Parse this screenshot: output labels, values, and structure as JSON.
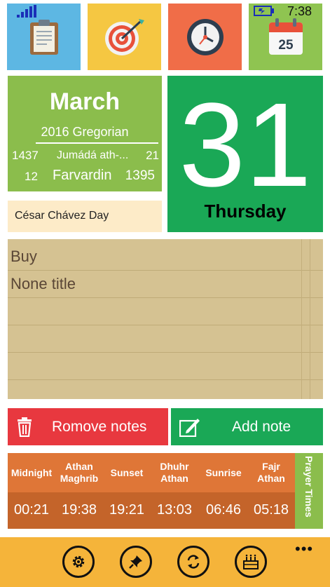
{
  "status_bar": {
    "time": "7:38",
    "icons": [
      "signal-icon",
      "battery-icon"
    ]
  },
  "tiles": [
    {
      "name": "notes-clipboard-icon",
      "color": "#5db7e3"
    },
    {
      "name": "target-icon",
      "color": "#f5c742"
    },
    {
      "name": "clock-icon",
      "color": "#f06d48"
    },
    {
      "name": "calendar-icon",
      "color": "#8fc451",
      "day": "25"
    }
  ],
  "date_panel": {
    "month": "March",
    "gregorian": "2016 Gregorian",
    "hijri": {
      "day": "1437",
      "month": "Jumádá ath-...",
      "year": "21"
    },
    "persian": {
      "day": "12",
      "month": "Farvardin",
      "year": "1395"
    },
    "holiday": "César Chávez Day"
  },
  "big_day": {
    "number": "31",
    "weekday": "Thursday"
  },
  "notes": [
    "Buy",
    "None title"
  ],
  "buttons": {
    "remove": "Romove notes",
    "add": "Add note"
  },
  "prayer": {
    "side_label": "Prayer Times",
    "columns": [
      {
        "name": "Midnight",
        "time": "00:21"
      },
      {
        "name": "Athan Maghrib",
        "time": "19:38"
      },
      {
        "name": "Sunset",
        "time": "19:21"
      },
      {
        "name": "Dhuhr Athan",
        "time": "13:03"
      },
      {
        "name": "Sunrise",
        "time": "06:46"
      },
      {
        "name": "Fajr Athan",
        "time": "05:18"
      }
    ]
  },
  "app_bar": {
    "buttons": [
      "settings-icon",
      "pin-icon",
      "refresh-icon",
      "birthday-cake-icon"
    ],
    "more": "•••"
  },
  "colors": {
    "green": "#1aa856",
    "olive": "#8bbd4c",
    "red": "#e8383f",
    "orange": "#df7637",
    "appbar": "#f5b43a"
  }
}
